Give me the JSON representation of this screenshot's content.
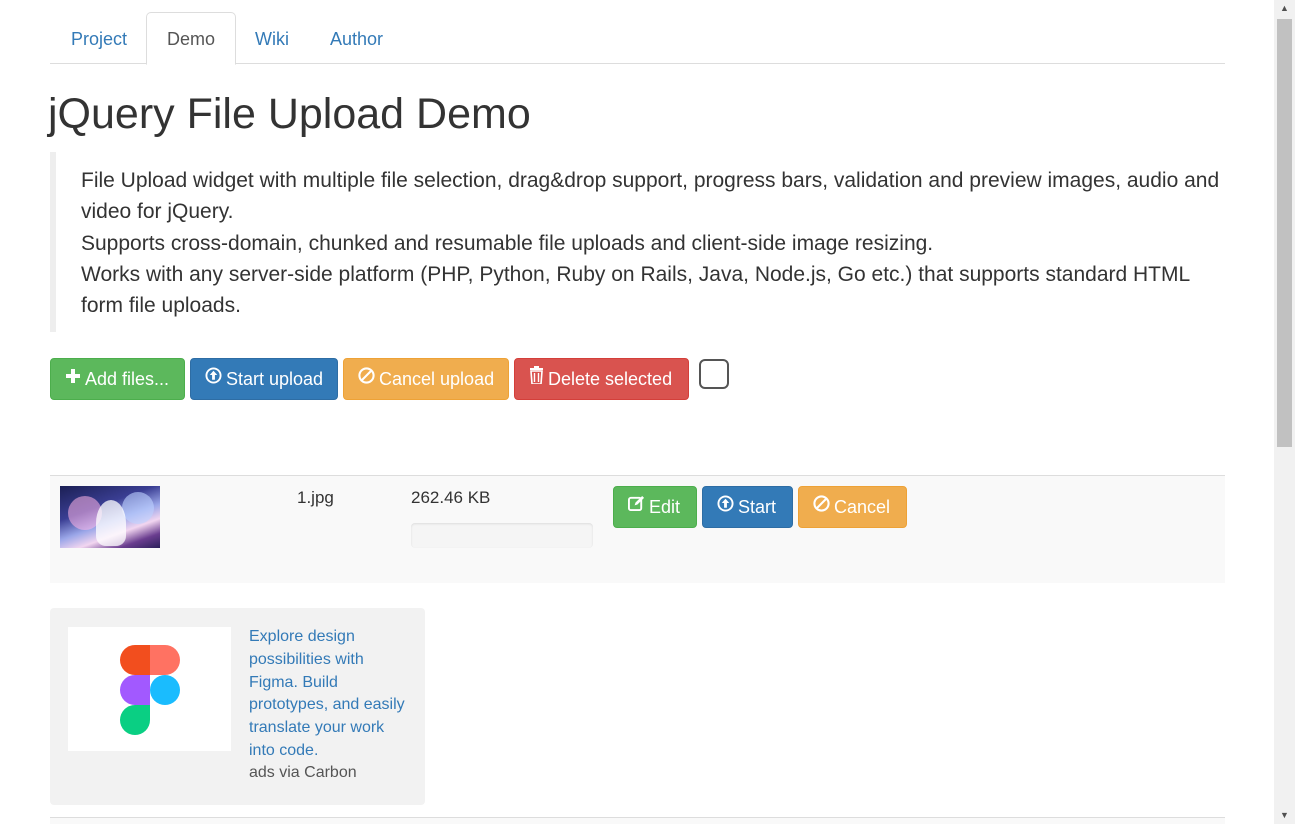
{
  "tabs": [
    {
      "label": "Project",
      "active": false
    },
    {
      "label": "Demo",
      "active": true
    },
    {
      "label": "Wiki",
      "active": false
    },
    {
      "label": "Author",
      "active": false
    }
  ],
  "title": "jQuery File Upload Demo",
  "description": [
    "File Upload widget with multiple file selection, drag&drop support, progress bars, validation and preview images, audio and video for jQuery.",
    "Supports cross-domain, chunked and resumable file uploads and client-side image resizing.",
    "Works with any server-side platform (PHP, Python, Ruby on Rails, Java, Node.js, Go etc.) that supports standard HTML form file uploads."
  ],
  "toolbar": {
    "add_files": "Add files...",
    "start_upload": "Start upload",
    "cancel_upload": "Cancel upload",
    "delete_selected": "Delete selected",
    "select_all_checked": false
  },
  "files": [
    {
      "name": "1.jpg",
      "size": "262.46 KB",
      "progress": 0,
      "actions": {
        "edit": "Edit",
        "start": "Start",
        "cancel": "Cancel"
      }
    }
  ],
  "ad": {
    "text": "Explore design possibilities with Figma. Build prototypes, and easily translate your work into code.",
    "via": "ads via Carbon",
    "logo_icon": "figma-logo"
  },
  "colors": {
    "link": "#337ab7",
    "success": "#5cb85c",
    "primary": "#337ab7",
    "warning": "#f0ad4e",
    "danger": "#d9534f"
  }
}
